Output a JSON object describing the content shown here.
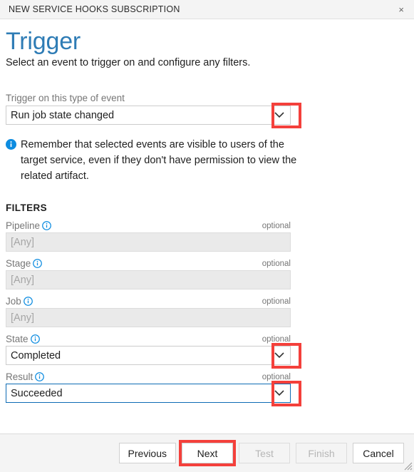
{
  "window": {
    "title": "NEW SERVICE HOOKS SUBSCRIPTION",
    "close_icon": "close-icon",
    "close_glyph": "×"
  },
  "page": {
    "title": "Trigger",
    "subtitle": "Select an event to trigger on and configure any filters."
  },
  "event": {
    "label": "Trigger on this type of event",
    "value": "Run job state changed",
    "caret_icon": "chevron-down-icon"
  },
  "note": {
    "icon": "info-filled-icon",
    "text": "Remember that selected events are visible to users of the target service, even if they don't have permission to view the related artifact."
  },
  "filters": {
    "heading": "FILTERS",
    "optional_label": "optional",
    "info_icon": "info-outline-icon",
    "items": [
      {
        "label": "Pipeline",
        "value": "[Any]",
        "state": "disabled",
        "has_caret": false
      },
      {
        "label": "Stage",
        "value": "[Any]",
        "state": "disabled",
        "has_caret": false
      },
      {
        "label": "Job",
        "value": "[Any]",
        "state": "disabled",
        "has_caret": false
      },
      {
        "label": "State",
        "value": "Completed",
        "state": "enabled",
        "has_caret": true
      },
      {
        "label": "Result",
        "value": "Succeeded",
        "state": "focused",
        "has_caret": true
      }
    ]
  },
  "footer": {
    "buttons": [
      {
        "label": "Previous",
        "state": "enabled",
        "highlighted": false
      },
      {
        "label": "Next",
        "state": "enabled",
        "highlighted": true
      },
      {
        "label": "Test",
        "state": "disabled",
        "highlighted": false
      },
      {
        "label": "Finish",
        "state": "disabled",
        "highlighted": false
      },
      {
        "label": "Cancel",
        "state": "enabled",
        "highlighted": false
      }
    ]
  },
  "colors": {
    "accent_blue": "#2e7cb5",
    "info_blue": "#0d8ce0",
    "highlight_red": "#f4403b",
    "focus_border": "#0d6bb5",
    "header_bg": "#f4f4f4"
  }
}
